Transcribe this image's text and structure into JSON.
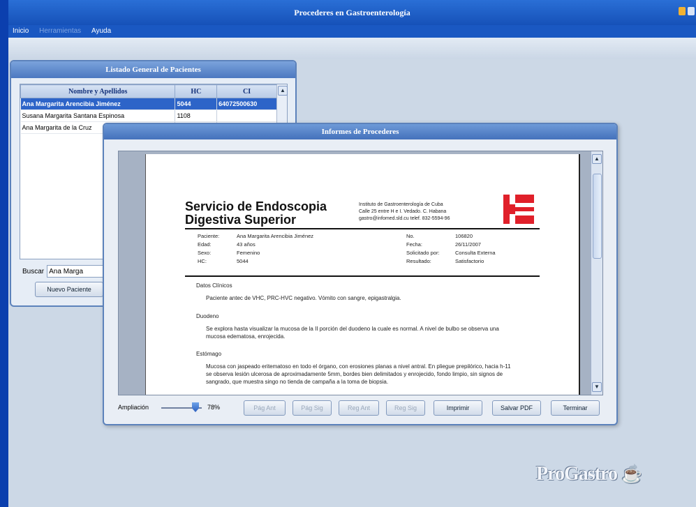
{
  "app": {
    "title": "Procederes en Gastroenterología"
  },
  "menu": [
    {
      "label": "Inicio",
      "enabled": true
    },
    {
      "label": "Herramientas",
      "enabled": false
    },
    {
      "label": "Ayuda",
      "enabled": true
    }
  ],
  "patients": {
    "title": "Listado General de Pacientes",
    "columns": [
      "Nombre y Apellidos",
      "HC",
      "CI"
    ],
    "rows": [
      [
        "Ana Margarita Arencibia Jiménez",
        "5044",
        "64072500630"
      ],
      [
        "Susana Margarita Santana Espinosa",
        "1108",
        ""
      ],
      [
        "Ana Margarita de la Cruz",
        "",
        ""
      ]
    ],
    "search_label": "Buscar",
    "search_value": "Ana Marga",
    "new_button": "Nuevo Paciente"
  },
  "report_window": {
    "title": "Informes de Procederes",
    "zoom_label": "Ampliación",
    "zoom_value": "78%",
    "zoom_level": 78,
    "buttons": {
      "prev_page": "Pág Ant",
      "next_page": "Pág Sig",
      "prev_record": "Reg Ant",
      "next_record": "Reg Sig",
      "print": "Imprimir",
      "save_pdf": "Salvar PDF",
      "finish": "Terminar"
    }
  },
  "report": {
    "title_line1": "Servicio de Endoscopia",
    "title_line2": "Digestiva Superior",
    "institute": [
      "Instituto de Gastroenterología de Cuba",
      "Calle 25 entre H e I. Vedado. C. Habana",
      "gastro@infomed.sld.cu telef. 832-5594-96"
    ],
    "left_fields": [
      {
        "k": "Paciente:",
        "v": "Ana Margarita Arencibia Jiménez"
      },
      {
        "k": "Edad:",
        "v": "43 años"
      },
      {
        "k": "Sexo:",
        "v": "Femenino"
      },
      {
        "k": "HC:",
        "v": "5044"
      }
    ],
    "right_fields": [
      {
        "k": "No.",
        "v": "106820"
      },
      {
        "k": "Fecha:",
        "v": "26/11/2007"
      },
      {
        "k": "Solicitado por:",
        "v": "Consulta Externa"
      },
      {
        "k": "Resultado:",
        "v": "Satisfactorio"
      }
    ],
    "sections": [
      {
        "heading": "Datos Clínicos",
        "body": "Paciente antec de VHC, PRC-HVC negativo. Vómito con sangre, epigastralgia."
      },
      {
        "heading": "Duodeno",
        "body": "Se explora hasta visualizar la mucosa de la II porción del duodeno la cuale es normal. A nivel de bulbo se observa una mucosa edematosa, enrojecida."
      },
      {
        "heading": "Estómago",
        "body": "Mucosa con jaspeado eritematoso en todo el órgano, con erosiones planas a nivel antral. En pliegue prepilórico, hacia h-11 se observa lesión ulcerosa de aproximadamente 5mm, bordes bien delimitados y enrojecido, fondo limpio, sin signos de sangrado, que muestra singo no tienda de campaña a la toma de biopsia."
      }
    ]
  },
  "brand": "ProGastro",
  "colors": {
    "desktop": "#0b3fae",
    "titlebar": "#1a58c2",
    "selection": "#2d64c8",
    "logo_red": "#e0202a"
  }
}
